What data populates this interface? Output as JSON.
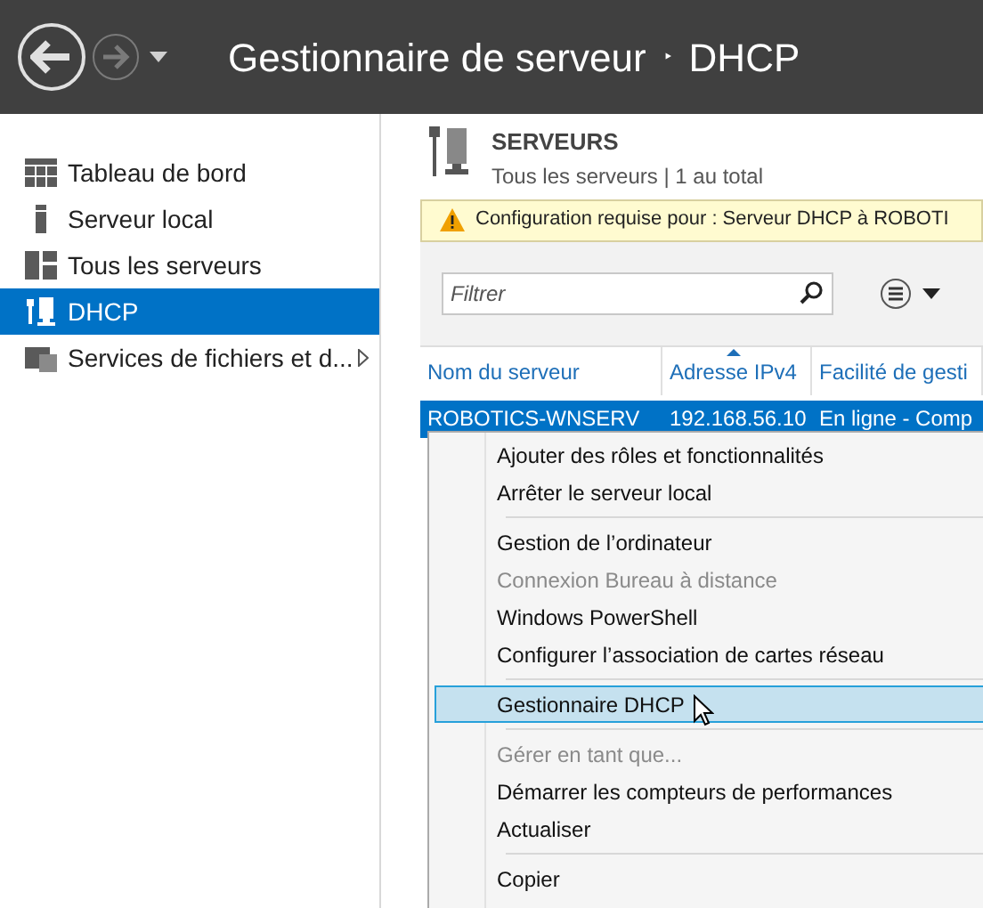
{
  "header": {
    "title": "Gestionnaire de serveur",
    "separator": "‣",
    "page": "DHCP"
  },
  "sidebar": {
    "items": [
      {
        "label": "Tableau de bord",
        "selected": false,
        "has_submenu": false
      },
      {
        "label": "Serveur local",
        "selected": false,
        "has_submenu": false
      },
      {
        "label": "Tous les serveurs",
        "selected": false,
        "has_submenu": false
      },
      {
        "label": "DHCP",
        "selected": true,
        "has_submenu": false
      },
      {
        "label": "Services de fichiers et d...",
        "selected": false,
        "has_submenu": true
      }
    ]
  },
  "servers_panel": {
    "title": "SERVEURS",
    "subtitle": "Tous les serveurs | 1 au total",
    "warning": "Configuration requise pour : Serveur DHCP à ROBOTI",
    "filter": {
      "placeholder": "Filtrer"
    },
    "columns": [
      {
        "label": "Nom du serveur",
        "sorted": false
      },
      {
        "label": "Adresse IPv4",
        "sorted": true
      },
      {
        "label": "Facilité de gesti",
        "sorted": false
      }
    ],
    "rows": [
      {
        "cells": [
          "ROBOTICS-WNSERV",
          "192.168.56.10",
          "En ligne - Comp"
        ],
        "selected": true
      }
    ]
  },
  "context_menu": {
    "items": [
      {
        "kind": "item",
        "label": "Ajouter des rôles et fonctionnalités",
        "disabled": false,
        "selected": false
      },
      {
        "kind": "item",
        "label": "Arrêter le serveur local",
        "disabled": false,
        "selected": false
      },
      {
        "kind": "separator"
      },
      {
        "kind": "item",
        "label": "Gestion de l’ordinateur",
        "disabled": false,
        "selected": false
      },
      {
        "kind": "item",
        "label": "Connexion Bureau à distance",
        "disabled": true,
        "selected": false
      },
      {
        "kind": "item",
        "label": "Windows PowerShell",
        "disabled": false,
        "selected": false
      },
      {
        "kind": "item",
        "label": "Configurer l’association de cartes réseau",
        "disabled": false,
        "selected": false
      },
      {
        "kind": "separator"
      },
      {
        "kind": "item",
        "label": "Gestionnaire DHCP",
        "disabled": false,
        "selected": true
      },
      {
        "kind": "separator"
      },
      {
        "kind": "item",
        "label": "Gérer en tant que...",
        "disabled": true,
        "selected": false
      },
      {
        "kind": "item",
        "label": "Démarrer les compteurs de performances",
        "disabled": false,
        "selected": false
      },
      {
        "kind": "item",
        "label": "Actualiser",
        "disabled": false,
        "selected": false
      },
      {
        "kind": "separator"
      },
      {
        "kind": "item",
        "label": "Copier",
        "disabled": false,
        "selected": false
      }
    ]
  }
}
